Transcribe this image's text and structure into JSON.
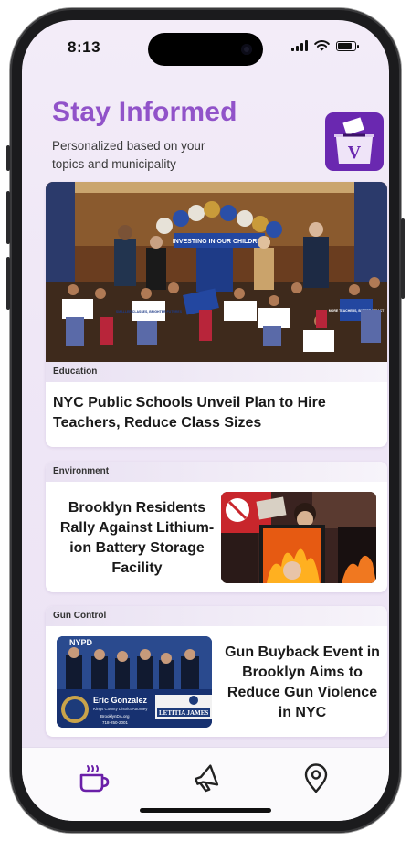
{
  "status_bar": {
    "time": "8:13"
  },
  "header": {
    "title": "Stay Informed",
    "subtitle": "Personalized based on your topics and municipality",
    "logo_letter": "V"
  },
  "articles": [
    {
      "category": "Education",
      "headline": "NYC Public Schools Unveil Plan to Hire Teachers, Reduce Class Sizes",
      "photo_signs": [
        "INVESTING IN OUR CHILDREN",
        "SMALLER CLASSES, BRIGHTER FUTURES",
        "MORE TEACHERS, BIGGER IMPACT"
      ]
    },
    {
      "category": "Environment",
      "headline": "Brooklyn Residents Rally Against Lithium-ion Battery Storage Facility"
    },
    {
      "category": "Gun Control",
      "headline": "Gun Buyback Event in Brooklyn Aims to Reduce Gun Violence in NYC",
      "photo_banner": [
        "NYPD",
        "Eric Gonzalez",
        "Kings County District Attorney",
        "BrooklynDA.org",
        "718-250-2001",
        "LETITIA JAMES"
      ]
    }
  ],
  "tabs": [
    {
      "icon": "coffee-cup-icon"
    },
    {
      "icon": "megaphone-icon"
    },
    {
      "icon": "location-pin-icon"
    }
  ],
  "colors": {
    "accent": "#9153c9",
    "logo_bg": "#6a28b0",
    "active_tab": "#6a1fa8",
    "inactive_tab": "#222222"
  }
}
